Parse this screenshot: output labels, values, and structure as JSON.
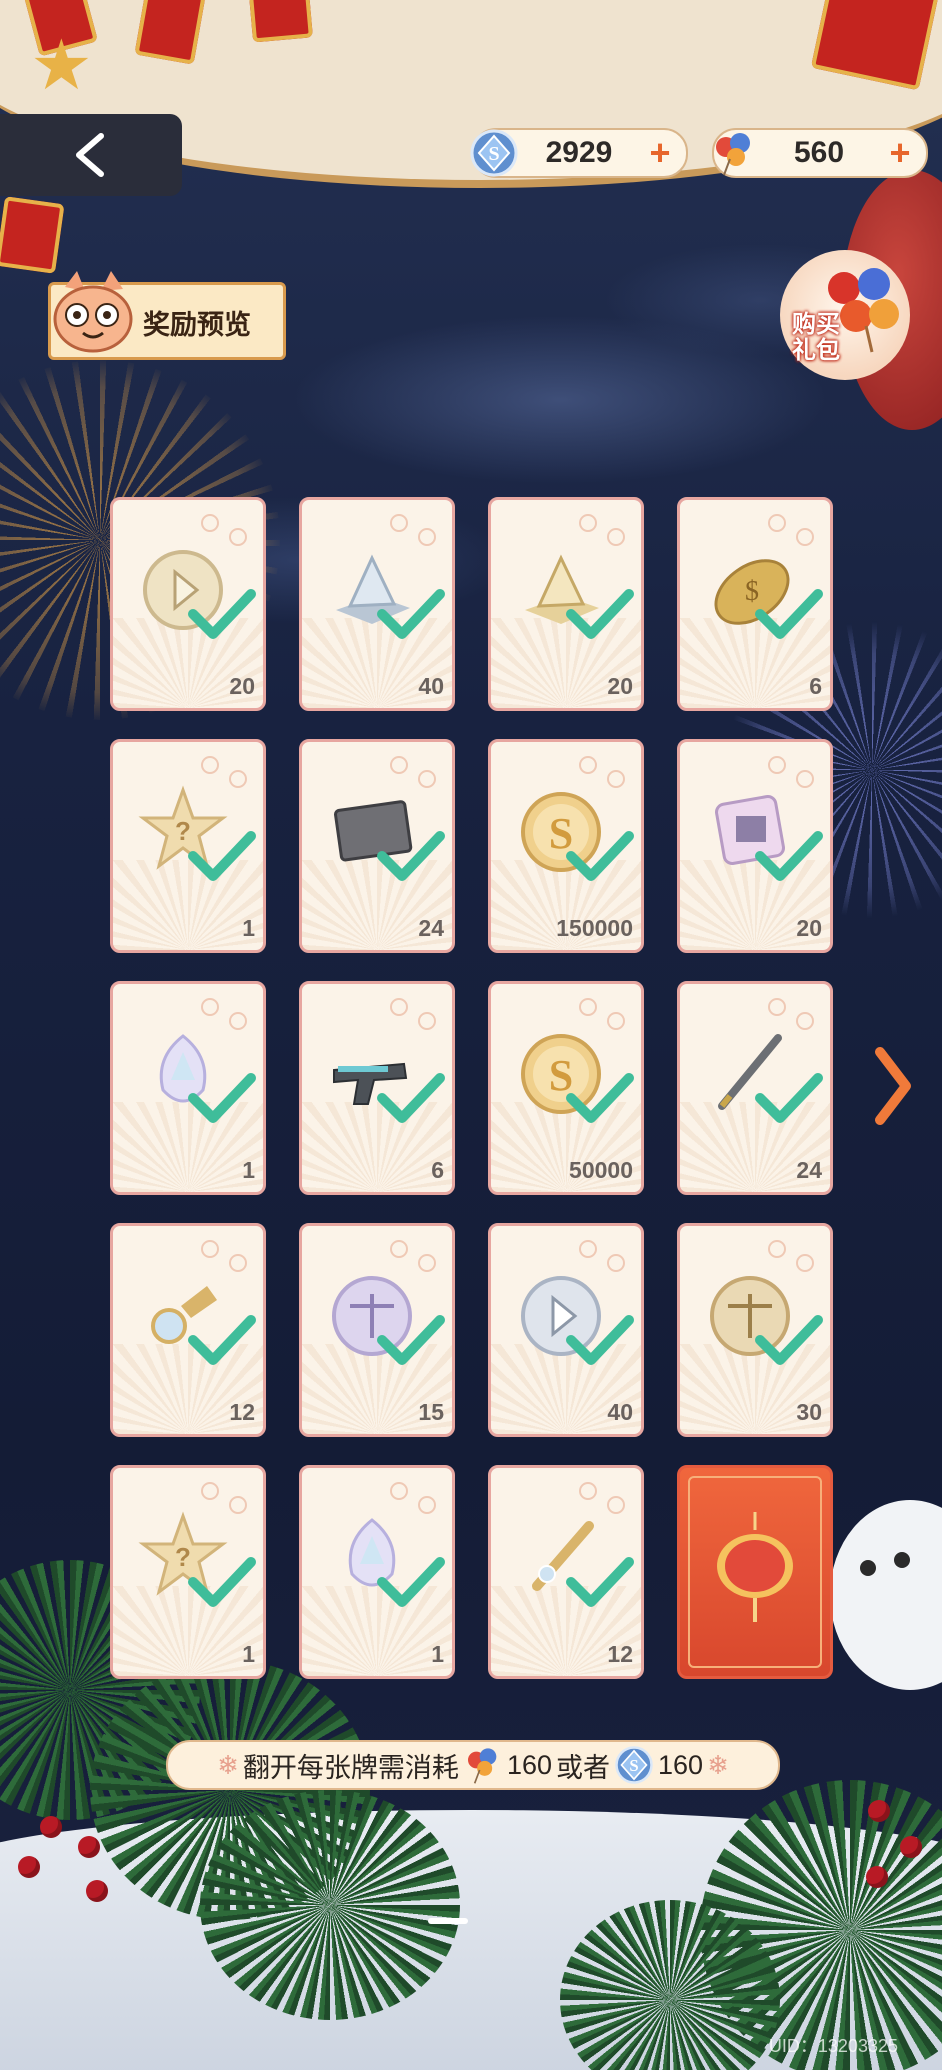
{
  "header": {
    "currency_diamond": {
      "icon": "s-coin-icon",
      "value": "2929",
      "plus": "+"
    },
    "currency_balloon": {
      "icon": "balloon-icon",
      "value": "560",
      "plus": "+"
    }
  },
  "reward_preview": {
    "label": "奖励预览",
    "icon": "cat-mascot-icon"
  },
  "buy_pack": {
    "label_line1": "购买",
    "label_line2": "礼包"
  },
  "cards": [
    {
      "item": "silver-token",
      "count": "20",
      "checked": true
    },
    {
      "item": "silver-pyramid",
      "count": "40",
      "checked": true
    },
    {
      "item": "gold-pyramid",
      "count": "20",
      "checked": true
    },
    {
      "item": "gold-coin",
      "count": "6",
      "checked": true
    },
    {
      "item": "mystery-star",
      "count": "1",
      "checked": true
    },
    {
      "item": "gray-card",
      "count": "24",
      "checked": true
    },
    {
      "item": "s-gold-coin",
      "count": "150000",
      "checked": true
    },
    {
      "item": "pink-box",
      "count": "20",
      "checked": true
    },
    {
      "item": "crystal-gem",
      "count": "1",
      "checked": true
    },
    {
      "item": "pistol",
      "count": "6",
      "checked": true
    },
    {
      "item": "s-gold-coin",
      "count": "50000",
      "checked": true
    },
    {
      "item": "fountain-pen",
      "count": "24",
      "checked": true
    },
    {
      "item": "cufflinks",
      "count": "12",
      "checked": true
    },
    {
      "item": "scales-purple-coin",
      "count": "15",
      "checked": true
    },
    {
      "item": "play-silver-coin",
      "count": "40",
      "checked": true
    },
    {
      "item": "scales-gold-coin",
      "count": "30",
      "checked": true
    },
    {
      "item": "mystery-star",
      "count": "1",
      "checked": true
    },
    {
      "item": "crystal-gem",
      "count": "1",
      "checked": true
    },
    {
      "item": "tie-clip",
      "count": "12",
      "checked": true
    },
    {
      "item": "red-lantern-card",
      "count": "",
      "checked": false
    }
  ],
  "cost_bar": {
    "prefix": "翻开每张牌需消耗",
    "amount_1": "160",
    "connector": "或者",
    "amount_2": "160"
  },
  "footer": {
    "uid": "UID：13203325"
  },
  "colors": {
    "accent": "#e7662b",
    "check": "#3fbd9a",
    "card_border": "#e7a6a0",
    "special_card": "#e55b3f"
  }
}
